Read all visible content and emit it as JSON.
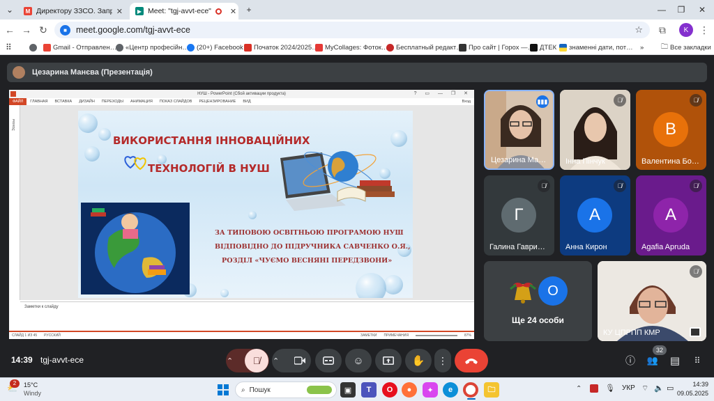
{
  "browser": {
    "tabs": [
      {
        "label": "Директору ЗЗСО. Запрошення",
        "favicon": "gmail-icon"
      },
      {
        "label": "Meet: \"tgj-avvt-ece\"",
        "favicon": "meet-icon"
      }
    ],
    "url": "meet.google.com/tgj-avvt-ece",
    "profile_initial": "K",
    "bookmarks": [
      {
        "label": "Gmail - Отправлен…"
      },
      {
        "label": "«Центр професійн…"
      },
      {
        "label": "(20+) Facebook"
      },
      {
        "label": "Початок 2024/2025…"
      },
      {
        "label": "MyCollages: Фоток…"
      },
      {
        "label": "Бесплатный редакт…"
      },
      {
        "label": "Про сайт | Горох —…"
      },
      {
        "label": "ДТЕК"
      },
      {
        "label": "знаменні дати, пот…"
      }
    ],
    "all_bookmarks": "Все закладки"
  },
  "meet": {
    "presenter_label": "Цезарина Манєва (Презентація)",
    "time": "14:39",
    "meeting_code": "tgj-avvt-ece",
    "participant_count": "32",
    "others_label": "Ще 24 особи",
    "others_initial": "О"
  },
  "participants": [
    {
      "name": "Цезарина Ма…",
      "type": "video",
      "speaking": true
    },
    {
      "name": "Інна Пінчук",
      "type": "video",
      "muted": true
    },
    {
      "name": "Валентина Бо…",
      "initial": "В",
      "bg": "#e8710a",
      "avatar": "#e8710a",
      "muted": true
    },
    {
      "name": "Галина Гаври…",
      "initial": "Г",
      "bg": "#3c4a4f",
      "avatar": "#5f6b70",
      "muted": true
    },
    {
      "name": "Анна Кирон",
      "initial": "А",
      "bg": "#174ea6",
      "avatar": "#1a73e8",
      "muted": true
    },
    {
      "name": "Agafia Apruda",
      "initial": "A",
      "bg": "#7b1fa2",
      "avatar": "#8e24aa",
      "muted": true
    },
    {
      "name": "КУ ЦПРПП КМР",
      "type": "video",
      "muted": true
    }
  ],
  "powerpoint": {
    "window_title": "НУШ - PowerPoint (Сбой активации продукта)",
    "ribbon_tabs": [
      "ФАЙЛ",
      "ГЛАВНАЯ",
      "ВСТАВКА",
      "ДИЗАЙН",
      "ПЕРЕХОДЫ",
      "АНИМАЦИЯ",
      "ПОКАЗ СЛАЙДОВ",
      "РЕЦЕНЗИРОВАНИЕ",
      "ВИД"
    ],
    "user": "Вход",
    "thumbnails_label": "Эскизы",
    "notes_placeholder": "Заметки к слайду",
    "status_left": "СЛАЙД 1 ИЗ 45",
    "status_lang": "РУССКИЙ",
    "status_notes": "ЗАМЕТКИ",
    "status_comments": "ПРИМЕЧАНИЯ",
    "zoom": "87%"
  },
  "slide": {
    "title_line1": "ВИКОРИСТАННЯ ІННОВАЦІЙНИХ",
    "title_line2": "ТЕХНОЛОГІЙ В НУШ",
    "sub1": "ЗА ТИПОВОЮ ОСВІТНЬОЮ ПРОГРАМОЮ НУШ",
    "sub2": "ВІДПОВІДНО ДО ПІДРУЧНИКА САВЧЕНКО О.Я.,",
    "sub3": "РОЗДІЛ «ЧУЄМО ВЕСНЯНІ ПЕРЕДЗВОНИ»"
  },
  "taskbar": {
    "temperature": "15°C",
    "weather": "Windy",
    "weather_badge": "2",
    "search_placeholder": "Пошук",
    "lang": "УКР",
    "clock_time": "14:39",
    "clock_date": "09.05.2025"
  },
  "colors": {
    "end_call": "#ea4335",
    "mic_off_bg": "#f9dedc",
    "accent": "#8ab4f8"
  }
}
